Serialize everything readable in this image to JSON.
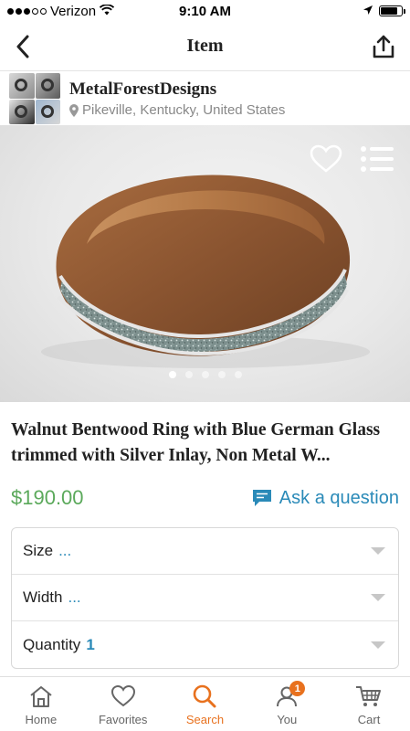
{
  "status_bar": {
    "carrier": "Verizon",
    "time": "9:10 AM",
    "battery_level": 0.8
  },
  "nav": {
    "title": "Item"
  },
  "shop": {
    "name": "MetalForestDesigns",
    "location": "Pikeville, Kentucky, United States"
  },
  "product": {
    "title": "Walnut Bentwood Ring with Blue German Glass trimmed with Silver Inlay, Non Metal W...",
    "price": "$190.00",
    "ask_label": "Ask a question",
    "image_count": 5,
    "active_image": 0
  },
  "options": [
    {
      "label": "Size",
      "value": "..."
    },
    {
      "label": "Width",
      "value": "..."
    },
    {
      "label": "Quantity",
      "value": "1"
    }
  ],
  "tabs": [
    {
      "label": "Home",
      "icon": "home-icon",
      "active": false
    },
    {
      "label": "Favorites",
      "icon": "heart-icon",
      "active": false
    },
    {
      "label": "Search",
      "icon": "search-icon",
      "active": true
    },
    {
      "label": "You",
      "icon": "you-icon",
      "active": false,
      "badge": "1"
    },
    {
      "label": "Cart",
      "icon": "cart-icon",
      "active": false
    }
  ],
  "colors": {
    "price_green": "#5ba95b",
    "link_blue": "#2a8ab8",
    "active_orange": "#e8711e"
  }
}
